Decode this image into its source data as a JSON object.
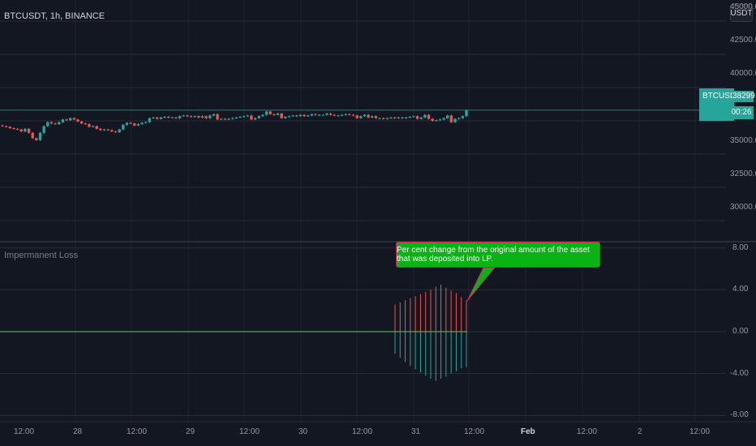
{
  "header": {
    "symbol_title": "BTCUSDT, 1h, BINANCE",
    "currency_badge": "USDT"
  },
  "price_scale": {
    "labels": [
      "45000.00",
      "42500.00",
      "40000.00",
      "35000.00",
      "32500.00",
      "30000.00"
    ],
    "current_price": "38299.00",
    "current_symbol": "BTCUSDT",
    "countdown": "00:26"
  },
  "indicator": {
    "name": "Impermanent Loss",
    "scale_labels": [
      "8.00",
      "4.00",
      "0.00",
      "-4.00",
      "-8.00"
    ],
    "annotation": "Per cent change from the original amount of the asset that was deposited into LP."
  },
  "time_axis": {
    "labels": [
      "12:00",
      "28",
      "12:00",
      "29",
      "12:00",
      "30",
      "12:00",
      "31",
      "12:00",
      "Feb",
      "12:00",
      "2",
      "12:00"
    ]
  },
  "colors": {
    "background": "#131722",
    "up": "#26a69a",
    "down": "#ef5350",
    "zero_line": "#4caf50",
    "callout_bg": "#09b313",
    "callout_border": "#d81b60"
  },
  "chart_data": {
    "type": "candlestick",
    "symbol": "BTCUSDT",
    "interval": "1h",
    "exchange": "BINANCE",
    "ylim": [
      28500,
      46000
    ],
    "current_price": 38299,
    "close_series": [
      37100,
      37050,
      36950,
      36900,
      36850,
      36700,
      36900,
      36600,
      36200,
      36050,
      36600,
      37100,
      37400,
      37300,
      37250,
      37400,
      37600,
      37550,
      37700,
      37600,
      37450,
      37300,
      37250,
      37050,
      37100,
      36900,
      36800,
      36850,
      36800,
      36700,
      36650,
      36850,
      37200,
      37350,
      37300,
      37150,
      37250,
      37350,
      37400,
      37700,
      37750,
      37650,
      37750,
      37800,
      37750,
      37750,
      37700,
      37850,
      37900,
      37850,
      37800,
      37850,
      37750,
      37850,
      37700,
      37900,
      38000,
      37600,
      37650,
      37600,
      37650,
      37700,
      37750,
      37800,
      37850,
      37900,
      37600,
      37700,
      37850,
      37950,
      38200,
      38000,
      37950,
      38050,
      37700,
      37800,
      37850,
      37900,
      37850,
      37950,
      37850,
      37900,
      38000,
      37950,
      37950,
      37950,
      38050,
      37950,
      37900,
      37900,
      37950,
      38000,
      37950,
      37900,
      37700,
      37850,
      37950,
      37750,
      37850,
      37700,
      37700,
      37650,
      37700,
      37750,
      37700,
      37750,
      37700,
      37750,
      37800,
      37850,
      37650,
      37750,
      37950,
      37650,
      37500,
      37550,
      37600,
      37700,
      37900,
      37400,
      37650,
      37700,
      37850,
      38300
    ],
    "indicator_series": [
      {
        "name": "Impermanent Loss",
        "type": "histogram",
        "values_pos": [
          2.6,
          2.8,
          3.0,
          3.2,
          3.4,
          3.6,
          3.8,
          4.0,
          4.3,
          4.5,
          4.2,
          3.9,
          3.7,
          3.3,
          3.0
        ],
        "values_neg": [
          -2.1,
          -2.5,
          -2.9,
          -3.3,
          -3.6,
          -3.9,
          -4.2,
          -4.5,
          -4.7,
          -4.5,
          -4.3,
          -4.0,
          -3.8,
          -3.5,
          -3.4
        ],
        "ylim": [
          -8,
          8
        ]
      }
    ]
  }
}
